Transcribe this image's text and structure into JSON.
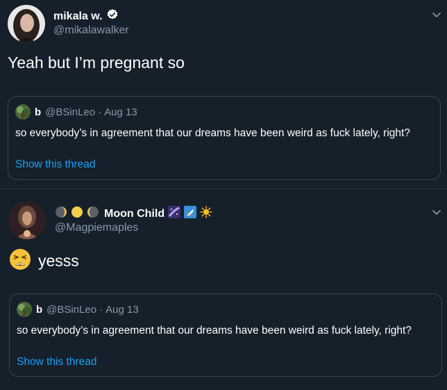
{
  "tweets": [
    {
      "author_name": "mikala w.",
      "author_handle": "@mikalawalker",
      "verified": true,
      "text": "Yeah but I’m pregnant so",
      "quote": {
        "name": "b",
        "handle": "@BSinLeo",
        "separator": "·",
        "date": "Aug 13",
        "text": "so everybody’s in agreement that our dreams have been weird as fuck lately, right?",
        "link": "Show this thread"
      }
    },
    {
      "author_name": "Moon Child",
      "author_handle": "@Magpiemaples",
      "text": "yesss",
      "quote": {
        "name": "b",
        "handle": "@BSinLeo",
        "separator": "·",
        "date": "Aug 13",
        "text": "so everybody’s in agreement that our dreams have been weird as fuck lately, right?",
        "link": "Show this thread"
      }
    }
  ],
  "icons": {
    "verified": "verified-badge-icon",
    "chevron": "chevron-down-icon",
    "name_prefix_emojis": [
      "waxing-moon-icon",
      "full-moon-icon",
      "waning-moon-icon"
    ],
    "name_suffix_emojis": [
      "milky-way-icon",
      "rocket-icon",
      "sun-icon"
    ],
    "body_emoji": "tired-face-icon"
  },
  "colors": {
    "background": "#15202b",
    "secondary_text": "#8899a6",
    "link": "#1da1f2",
    "border": "#38444d"
  }
}
